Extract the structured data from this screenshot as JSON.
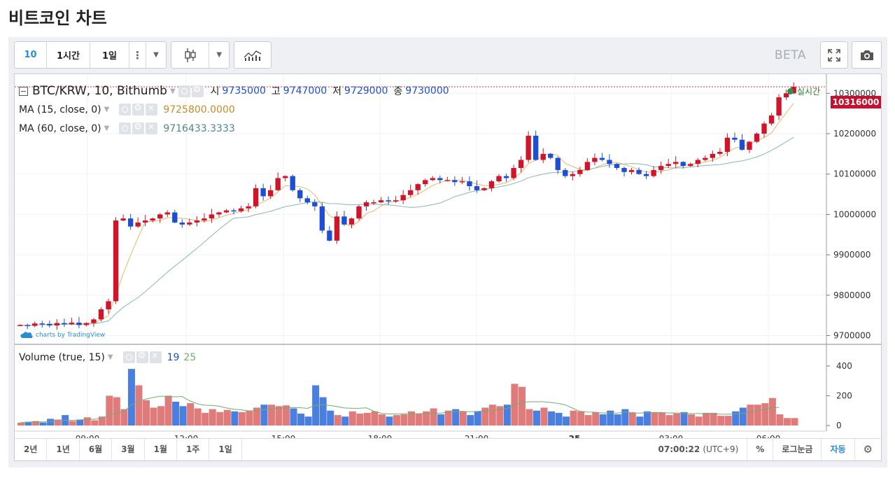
{
  "page": {
    "title": "비트코인 차트"
  },
  "toolbar": {
    "interval_active": "10",
    "interval_1h": "1시간",
    "interval_1d": "1일",
    "beta": "BETA"
  },
  "legend": {
    "symbol": "BTC/KRW, 10, Bithumb",
    "open_label": "시",
    "open": "9735000",
    "high_label": "고",
    "high": "9747000",
    "low_label": "저",
    "low": "9729000",
    "close_label": "종",
    "close": "9730000",
    "ma15_label": "MA (15, close, 0)",
    "ma15_value": "9725800.0000",
    "ma60_label": "MA (60, close, 0)",
    "ma60_value": "9716433.3333",
    "realtime": "실시간",
    "price_tag": "10316000",
    "volume_label": "Volume (true, 15)",
    "volume_val1": "19",
    "volume_val2": "25",
    "attribution": "charts by TradingView"
  },
  "colors": {
    "up": "#d0152a",
    "down": "#1f4fd1",
    "vol_up": "#e07b7b",
    "vol_down": "#4a7fe0",
    "ma15": "#e8b86a",
    "ma60": "#8ab8b0",
    "accent": "#2a8dd4"
  },
  "bottombar": {
    "ranges": [
      "2년",
      "1년",
      "6월",
      "3월",
      "1월",
      "1주",
      "1일"
    ],
    "time": "07:00:22",
    "tz": "(UTC+9)",
    "percent": "%",
    "log": "로그눈금",
    "auto": "자동"
  },
  "chart_data": {
    "type": "candlestick",
    "price_axis": {
      "ticks": [
        "10300000",
        "10200000",
        "10100000",
        "10000000",
        "9900000",
        "9800000",
        "9700000"
      ]
    },
    "volume_axis": {
      "ticks": [
        "400",
        "200",
        "0"
      ]
    },
    "time_axis": {
      "ticks": [
        "09:00",
        "12:00",
        "15:00",
        "18:00",
        "21:00",
        "25",
        "03:00",
        "06:00"
      ]
    },
    "candles_close_sampled": [
      9726000,
      9724000,
      9730000,
      9729000,
      9725000,
      9731000,
      9728000,
      9732000,
      9726000,
      9731000,
      9740000,
      9765000,
      9785000,
      9985000,
      9990000,
      9970000,
      9980000,
      9985000,
      9990000,
      10000000,
      10005000,
      9980000,
      9975000,
      9980000,
      9985000,
      9990000,
      10000000,
      10005000,
      10010000,
      10008000,
      10015000,
      10020000,
      10065000,
      10045000,
      10060000,
      10090000,
      10095000,
      10060000,
      10040000,
      10030000,
      10020000,
      9960000,
      9935000,
      9995000,
      9975000,
      9990000,
      10020000,
      10030000,
      10030000,
      10035000,
      10032000,
      10035000,
      10048000,
      10060000,
      10075000,
      10085000,
      10090000,
      10085000,
      10085000,
      10080000,
      10082000,
      10070000,
      10060000,
      10065000,
      10082000,
      10095000,
      10090000,
      10115000,
      10135000,
      10195000,
      10135000,
      10150000,
      10140000,
      10110000,
      10095000,
      10100000,
      10110000,
      10130000,
      10140000,
      10135000,
      10125000,
      10115000,
      10105000,
      10110000,
      10100000,
      10095000,
      10110000,
      10120000,
      10125000,
      10130000,
      10120000,
      10125000,
      10135000,
      10140000,
      10150000,
      10155000,
      10190000,
      10185000,
      10160000,
      10180000,
      10200000,
      10225000,
      10245000,
      10290000,
      10300000,
      10316000
    ],
    "volume_sampled": [
      19,
      25,
      30,
      20,
      45,
      40,
      70,
      30,
      40,
      55,
      35,
      60,
      200,
      190,
      110,
      380,
      270,
      170,
      120,
      130,
      200,
      160,
      130,
      150,
      115,
      85,
      110,
      90,
      105,
      95,
      90,
      100,
      120,
      140,
      140,
      130,
      135,
      115,
      80,
      60,
      270,
      190,
      100,
      70,
      60,
      95,
      80,
      85,
      95,
      75,
      60,
      70,
      75,
      95,
      80,
      95,
      115,
      75,
      100,
      110,
      95,
      70,
      95,
      120,
      140,
      130,
      140,
      280,
      260,
      110,
      100,
      120,
      95,
      85,
      60,
      100,
      95,
      70,
      90,
      75,
      100,
      75,
      110,
      85,
      60,
      95,
      90,
      85,
      70,
      80,
      90,
      75,
      60,
      85,
      85,
      65,
      65,
      95,
      120,
      140,
      140,
      150,
      185,
      75
    ]
  }
}
